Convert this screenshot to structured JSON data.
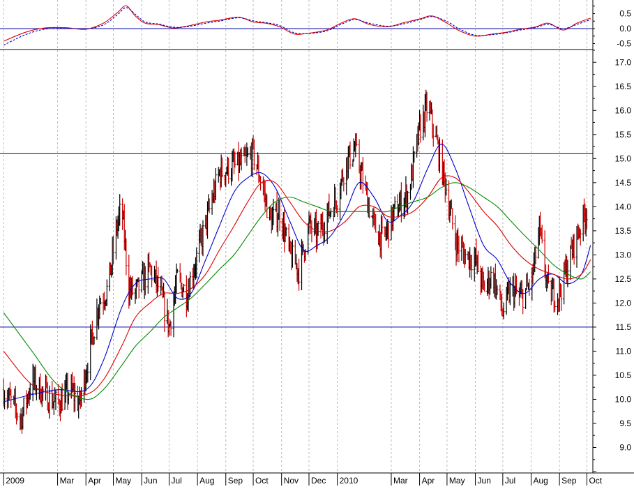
{
  "colors": {
    "price_up": "#000000",
    "price_down": "#cc0000",
    "ma_fast": "#0000cc",
    "ma_mid": "#dd0000",
    "ma_slow": "#008800",
    "hline": "#0000aa",
    "grid": "#bbbbbb",
    "osc_line": "#dd0000",
    "osc_signal": "#0000cc"
  },
  "chart_data": [
    {
      "type": "line",
      "panel": "oscillator",
      "ylim": [
        -0.6,
        0.72
      ],
      "y_ticks": [
        "0.5",
        "0.0",
        "-0.5"
      ],
      "y_tick_values": [
        0.5,
        0.0,
        -0.5
      ],
      "hlines": [
        0.0
      ],
      "grid": true,
      "series": [
        {
          "style": "solid",
          "color_key": "osc_line",
          "x": [
            "2009-01-01",
            "2009-01-25",
            "2009-02-15",
            "2009-03-10",
            "2009-04-01",
            "2009-04-20",
            "2009-05-05",
            "2009-05-15",
            "2009-05-25",
            "2009-06-05",
            "2009-06-20",
            "2009-07-05",
            "2009-07-20",
            "2009-08-10",
            "2009-08-25",
            "2009-09-15",
            "2009-10-01",
            "2009-10-15",
            "2009-10-30",
            "2009-11-15",
            "2009-12-01",
            "2009-12-20",
            "2010-01-05",
            "2010-01-20",
            "2010-02-05",
            "2010-02-25",
            "2010-03-15",
            "2010-04-01",
            "2010-04-15",
            "2010-05-01",
            "2010-05-15",
            "2010-06-01",
            "2010-06-20",
            "2010-07-05",
            "2010-07-20",
            "2010-08-05",
            "2010-08-20",
            "2010-09-05",
            "2010-09-20",
            "2010-10-05"
          ],
          "y": [
            -0.42,
            -0.12,
            0.02,
            0.03,
            -0.02,
            0.18,
            0.52,
            0.76,
            0.42,
            0.18,
            0.13,
            0.02,
            0.08,
            0.22,
            0.28,
            0.38,
            0.22,
            0.18,
            0.06,
            -0.18,
            -0.15,
            -0.05,
            0.18,
            0.33,
            0.14,
            0.06,
            0.2,
            0.32,
            0.42,
            0.18,
            -0.08,
            -0.25,
            -0.18,
            -0.12,
            -0.02,
            0.05,
            0.18,
            -0.05,
            0.18,
            0.35
          ]
        },
        {
          "style": "dashed",
          "color_key": "osc_signal",
          "x": [
            "2009-01-01",
            "2009-01-25",
            "2009-02-15",
            "2009-03-10",
            "2009-04-01",
            "2009-04-20",
            "2009-05-05",
            "2009-05-15",
            "2009-05-25",
            "2009-06-05",
            "2009-06-20",
            "2009-07-05",
            "2009-07-20",
            "2009-08-10",
            "2009-08-25",
            "2009-09-15",
            "2009-10-01",
            "2009-10-15",
            "2009-10-30",
            "2009-11-15",
            "2009-12-01",
            "2009-12-20",
            "2010-01-05",
            "2010-01-20",
            "2010-02-05",
            "2010-02-25",
            "2010-03-15",
            "2010-04-01",
            "2010-04-15",
            "2010-05-01",
            "2010-05-15",
            "2010-06-01",
            "2010-06-20",
            "2010-07-05",
            "2010-07-20",
            "2010-08-05",
            "2010-08-20",
            "2010-09-05",
            "2010-09-20",
            "2010-10-05"
          ],
          "y": [
            -0.55,
            -0.2,
            -0.02,
            0.01,
            -0.01,
            0.12,
            0.45,
            0.7,
            0.48,
            0.22,
            0.15,
            0.05,
            0.06,
            0.18,
            0.25,
            0.36,
            0.26,
            0.2,
            0.1,
            -0.14,
            -0.16,
            -0.08,
            0.14,
            0.3,
            0.18,
            0.08,
            0.16,
            0.3,
            0.4,
            0.24,
            -0.02,
            -0.22,
            -0.2,
            -0.14,
            -0.05,
            0.03,
            0.14,
            0.0,
            0.14,
            0.3
          ]
        }
      ]
    },
    {
      "type": "line",
      "panel": "price",
      "ylim": [
        8.5,
        17.25
      ],
      "y_ticks": [
        "17.0",
        "16.5",
        "16.0",
        "15.5",
        "15.0",
        "14.5",
        "14.0",
        "13.5",
        "13.0",
        "12.5",
        "12.0",
        "11.5",
        "11.0",
        "10.5",
        "10.0",
        "9.5",
        "9.0"
      ],
      "y_tick_values": [
        17.0,
        16.5,
        16.0,
        15.5,
        15.0,
        14.5,
        14.0,
        13.5,
        13.0,
        12.5,
        12.0,
        11.5,
        11.0,
        10.5,
        10.0,
        9.5,
        9.0
      ],
      "hlines": [
        15.1,
        11.5
      ],
      "grid": true,
      "x_ticks": [
        "2009",
        "Mar",
        "Apr",
        "May",
        "Jun",
        "Jul",
        "Aug",
        "Sep",
        "Oct",
        "Nov",
        "Dec",
        "2010",
        "Mar",
        "Apr",
        "May",
        "Jun",
        "Jul",
        "Aug",
        "Sep",
        "Oct"
      ],
      "x_tick_dates": [
        "2009-01-01",
        "2009-03-01",
        "2009-04-01",
        "2009-05-01",
        "2009-06-01",
        "2009-07-01",
        "2009-08-01",
        "2009-09-01",
        "2009-10-01",
        "2009-11-01",
        "2009-12-01",
        "2010-01-01",
        "2010-03-01",
        "2010-04-01",
        "2010-05-01",
        "2010-06-01",
        "2010-07-01",
        "2010-08-01",
        "2010-09-01",
        "2010-10-01"
      ],
      "price_anchors": {
        "x": [
          "2009-01-01",
          "2009-01-20",
          "2009-02-01",
          "2009-02-15",
          "2009-03-01",
          "2009-03-15",
          "2009-03-25",
          "2009-04-05",
          "2009-04-15",
          "2009-04-25",
          "2009-05-05",
          "2009-05-10",
          "2009-05-18",
          "2009-05-25",
          "2009-06-10",
          "2009-06-20",
          "2009-07-01",
          "2009-07-10",
          "2009-07-20",
          "2009-08-01",
          "2009-08-15",
          "2009-08-25",
          "2009-09-05",
          "2009-09-20",
          "2009-10-01",
          "2009-10-10",
          "2009-10-20",
          "2009-10-30",
          "2009-11-10",
          "2009-11-20",
          "2009-12-01",
          "2009-12-10",
          "2009-12-20",
          "2010-01-01",
          "2010-01-10",
          "2010-01-20",
          "2010-02-01",
          "2010-02-10",
          "2010-02-20",
          "2010-03-05",
          "2010-03-20",
          "2010-04-01",
          "2010-04-10",
          "2010-04-20",
          "2010-05-01",
          "2010-05-10",
          "2010-05-20",
          "2010-06-01",
          "2010-06-10",
          "2010-06-20",
          "2010-07-01",
          "2010-07-10",
          "2010-07-20",
          "2010-08-01",
          "2010-08-10",
          "2010-08-20",
          "2010-09-01",
          "2010-09-10",
          "2010-09-20",
          "2010-10-02"
        ],
        "y": [
          10.2,
          9.6,
          10.4,
          10.1,
          9.9,
          10.2,
          9.9,
          11.0,
          12.0,
          12.3,
          13.6,
          14.0,
          12.3,
          12.2,
          12.7,
          12.3,
          11.5,
          12.5,
          12.2,
          13.0,
          14.0,
          14.7,
          14.8,
          14.9,
          15.1,
          14.5,
          13.7,
          13.9,
          13.0,
          12.7,
          13.6,
          13.4,
          13.8,
          14.2,
          14.9,
          15.2,
          14.3,
          13.6,
          13.3,
          13.9,
          14.3,
          15.6,
          16.1,
          15.3,
          14.3,
          13.3,
          13.0,
          12.9,
          12.3,
          12.6,
          11.8,
          12.3,
          12.1,
          12.4,
          13.5,
          12.2,
          12.2,
          12.8,
          13.4,
          14.0
        ]
      },
      "series": [
        {
          "color_key": "ma_fast",
          "x": [
            "2009-01-01",
            "2009-02-01",
            "2009-03-01",
            "2009-04-01",
            "2009-04-20",
            "2009-05-10",
            "2009-05-25",
            "2009-06-10",
            "2009-06-25",
            "2009-07-10",
            "2009-07-25",
            "2009-08-10",
            "2009-08-25",
            "2009-09-10",
            "2009-09-25",
            "2009-10-10",
            "2009-10-25",
            "2009-11-10",
            "2009-11-25",
            "2009-12-10",
            "2009-12-25",
            "2010-01-10",
            "2010-01-25",
            "2010-02-10",
            "2010-02-25",
            "2010-03-10",
            "2010-03-25",
            "2010-04-10",
            "2010-04-25",
            "2010-05-10",
            "2010-05-25",
            "2010-06-10",
            "2010-06-25",
            "2010-07-10",
            "2010-07-25",
            "2010-08-10",
            "2010-08-25",
            "2010-09-10",
            "2010-09-25",
            "2010-10-05"
          ],
          "y": [
            9.95,
            10.1,
            10.2,
            10.2,
            10.8,
            11.9,
            12.4,
            12.5,
            12.5,
            12.1,
            12.2,
            12.9,
            13.6,
            14.3,
            14.6,
            14.7,
            14.4,
            13.7,
            13.1,
            13.2,
            13.4,
            13.9,
            14.5,
            14.2,
            13.7,
            13.8,
            14.1,
            14.8,
            15.3,
            14.8,
            14.0,
            13.2,
            12.9,
            12.4,
            12.2,
            12.5,
            12.6,
            12.4,
            12.6,
            13.2
          ]
        },
        {
          "color_key": "ma_mid",
          "x": [
            "2009-01-01",
            "2009-02-01",
            "2009-03-01",
            "2009-04-01",
            "2009-04-20",
            "2009-05-10",
            "2009-05-25",
            "2009-06-10",
            "2009-06-25",
            "2009-07-10",
            "2009-07-25",
            "2009-08-10",
            "2009-08-25",
            "2009-09-10",
            "2009-09-25",
            "2009-10-10",
            "2009-10-25",
            "2009-11-10",
            "2009-11-25",
            "2009-12-10",
            "2009-12-25",
            "2010-01-10",
            "2010-01-25",
            "2010-02-10",
            "2010-02-25",
            "2010-03-10",
            "2010-03-25",
            "2010-04-10",
            "2010-04-25",
            "2010-05-10",
            "2010-05-25",
            "2010-06-10",
            "2010-06-25",
            "2010-07-10",
            "2010-07-25",
            "2010-08-10",
            "2010-08-25",
            "2010-09-10",
            "2010-09-25",
            "2010-10-05"
          ],
          "y": [
            11.0,
            10.3,
            10.1,
            10.1,
            10.4,
            11.1,
            11.7,
            12.0,
            12.2,
            12.2,
            12.3,
            12.6,
            13.1,
            13.6,
            14.1,
            14.5,
            14.5,
            14.1,
            13.7,
            13.5,
            13.5,
            13.7,
            14.0,
            14.0,
            13.8,
            13.8,
            13.9,
            14.2,
            14.6,
            14.6,
            14.3,
            13.9,
            13.6,
            13.2,
            12.9,
            12.7,
            12.6,
            12.5,
            12.6,
            12.9
          ]
        },
        {
          "color_key": "ma_slow",
          "x": [
            "2009-01-01",
            "2009-02-01",
            "2009-03-01",
            "2009-04-01",
            "2009-04-20",
            "2009-05-10",
            "2009-05-25",
            "2009-06-10",
            "2009-06-25",
            "2009-07-10",
            "2009-07-25",
            "2009-08-10",
            "2009-08-25",
            "2009-09-10",
            "2009-09-25",
            "2009-10-10",
            "2009-10-25",
            "2009-11-10",
            "2009-11-25",
            "2009-12-10",
            "2009-12-25",
            "2010-01-10",
            "2010-01-25",
            "2010-02-10",
            "2010-02-25",
            "2010-03-10",
            "2010-03-25",
            "2010-04-10",
            "2010-04-25",
            "2010-05-10",
            "2010-05-25",
            "2010-06-10",
            "2010-06-25",
            "2010-07-10",
            "2010-07-25",
            "2010-08-10",
            "2010-08-25",
            "2010-09-10",
            "2010-09-25",
            "2010-10-05"
          ],
          "y": [
            11.8,
            11.0,
            10.3,
            10.0,
            10.2,
            10.7,
            11.1,
            11.4,
            11.7,
            11.9,
            12.1,
            12.4,
            12.7,
            13.0,
            13.4,
            13.8,
            14.1,
            14.2,
            14.1,
            14.0,
            13.9,
            13.9,
            13.9,
            13.9,
            13.9,
            14.0,
            14.1,
            14.2,
            14.4,
            14.5,
            14.4,
            14.2,
            14.0,
            13.7,
            13.4,
            13.1,
            12.8,
            12.6,
            12.5,
            12.65
          ]
        }
      ]
    }
  ]
}
